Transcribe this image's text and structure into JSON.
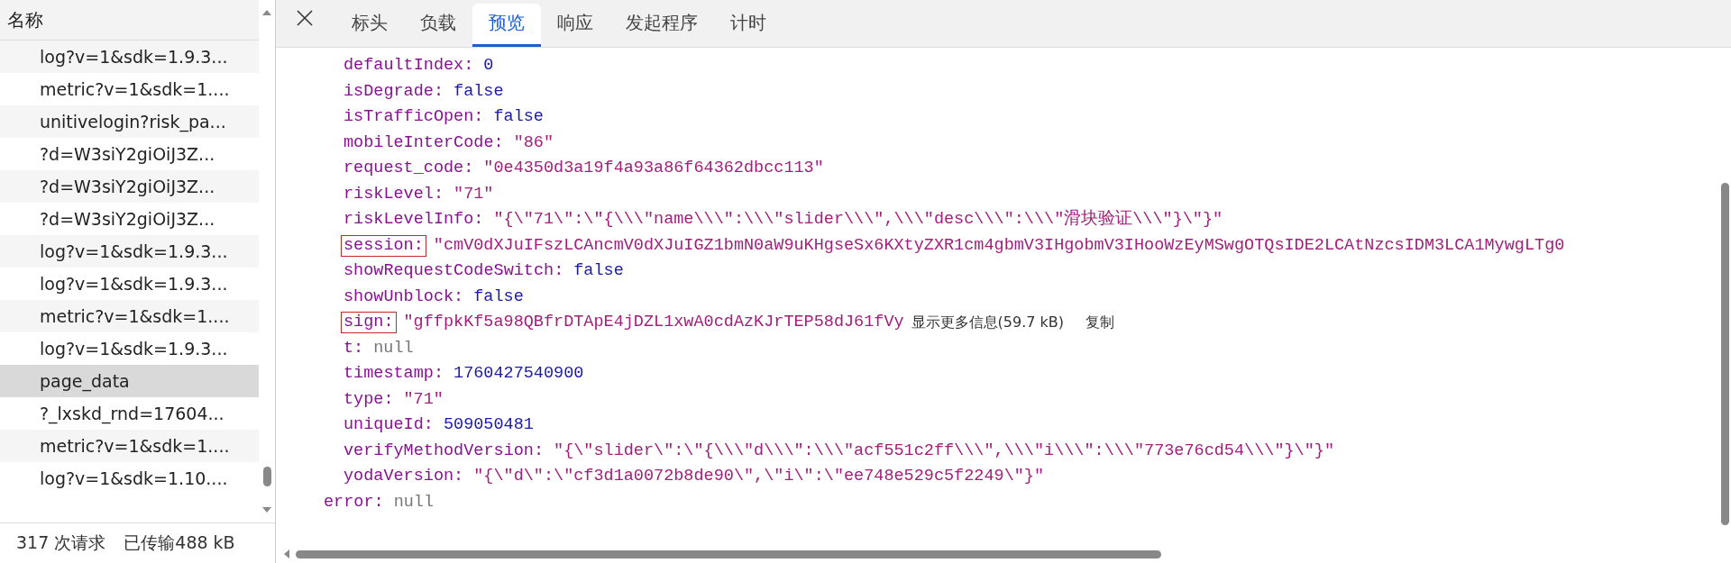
{
  "request_list": {
    "header": "名称",
    "rows": [
      {
        "name": "log?v=1&sdk=1.9.3...",
        "selected": false
      },
      {
        "name": "metric?v=1&sdk=1....",
        "selected": false
      },
      {
        "name": "unitivelogin?risk_pa...",
        "selected": false
      },
      {
        "name": "?d=W3siY2giOiJ3Z...",
        "selected": false
      },
      {
        "name": "?d=W3siY2giOiJ3Z...",
        "selected": false
      },
      {
        "name": "?d=W3siY2giOiJ3Z...",
        "selected": false
      },
      {
        "name": "log?v=1&sdk=1.9.3...",
        "selected": false
      },
      {
        "name": "log?v=1&sdk=1.9.3...",
        "selected": false
      },
      {
        "name": "metric?v=1&sdk=1....",
        "selected": false
      },
      {
        "name": "log?v=1&sdk=1.9.3...",
        "selected": false
      },
      {
        "name": "page_data",
        "selected": true
      },
      {
        "name": "?_lxskd_rnd=17604...",
        "selected": false
      },
      {
        "name": "metric?v=1&sdk=1....",
        "selected": false
      },
      {
        "name": "log?v=1&sdk=1.10....",
        "selected": false
      }
    ],
    "status": {
      "requests": "317 次请求",
      "transferred": "已传输488 kB"
    }
  },
  "tabs": [
    {
      "label": "标头",
      "selected": false
    },
    {
      "label": "负载",
      "selected": false
    },
    {
      "label": "预览",
      "selected": true
    },
    {
      "label": "响应",
      "selected": false
    },
    {
      "label": "发起程序",
      "selected": false
    },
    {
      "label": "计时",
      "selected": false
    }
  ],
  "preview": {
    "lines": [
      {
        "key": "defaultIndex:",
        "value": "0",
        "kind": "number",
        "highlighted": false
      },
      {
        "key": "isDegrade:",
        "value": "false",
        "kind": "boolean",
        "highlighted": false
      },
      {
        "key": "isTrafficOpen:",
        "value": "false",
        "kind": "boolean",
        "highlighted": false
      },
      {
        "key": "mobileInterCode:",
        "value": "\"86\"",
        "kind": "string",
        "highlighted": false
      },
      {
        "key": "request_code:",
        "value": "\"0e4350d3a19f4a93a86f64362dbcc113\"",
        "kind": "string",
        "highlighted": false
      },
      {
        "key": "riskLevel:",
        "value": "\"71\"",
        "kind": "string",
        "highlighted": false
      },
      {
        "key": "riskLevelInfo:",
        "value": "\"{\\\"71\\\":\\\"{\\\\\\\"name\\\\\\\":\\\\\\\"slider\\\\\\\",\\\\\\\"desc\\\\\\\":\\\\\\\"滑块验证\\\\\\\"}\\\"}\"",
        "kind": "string",
        "highlighted": false
      },
      {
        "key": "session:",
        "value": "\"cmV0dXJuIFszLCAncmV0dXJuIGZ1bmN0aW9uKHgseSx6KXtyZXR1cm4gbmV3IHgobmV3IHooWzEyMSwgOTQsIDE2LCAtNzcsIDM3LCA1MywgLTg0",
        "kind": "string",
        "highlighted": true
      },
      {
        "key": "showRequestCodeSwitch:",
        "value": "false",
        "kind": "boolean",
        "highlighted": false
      },
      {
        "key": "showUnblock:",
        "value": "false",
        "kind": "boolean",
        "highlighted": false
      },
      {
        "key": "sign:",
        "value": "\"gffpkKf5a98QBfrDTApE4jDZL1xwA0cdAzKJrTEP58dJ61fVy",
        "kind": "string",
        "highlighted": true,
        "more": "显示更多信息(59.7 kB)",
        "copy": "复制"
      },
      {
        "key": "t:",
        "value": "null",
        "kind": "null",
        "highlighted": false
      },
      {
        "key": "timestamp:",
        "value": "1760427540900",
        "kind": "number",
        "highlighted": false
      },
      {
        "key": "type:",
        "value": "\"71\"",
        "kind": "string",
        "highlighted": false
      },
      {
        "key": "uniqueId:",
        "value": "509050481",
        "kind": "number",
        "highlighted": false
      },
      {
        "key": "verifyMethodVersion:",
        "value": "\"{\\\"slider\\\":\\\"{\\\\\\\"d\\\\\\\":\\\\\\\"acf551c2ff\\\\\\\",\\\\\\\"i\\\\\\\":\\\\\\\"773e76cd54\\\\\\\"}\\\"}\"",
        "kind": "string",
        "highlighted": false
      },
      {
        "key": "yodaVersion:",
        "value": "\"{\\\"d\\\":\\\"cf3d1a0072b8de90\\\",\\\"i\\\":\\\"ee748e529c5f2249\\\"}\"",
        "kind": "string",
        "highlighted": false
      }
    ],
    "footer": {
      "key": "error:",
      "value": "null",
      "kind": "null"
    }
  }
}
